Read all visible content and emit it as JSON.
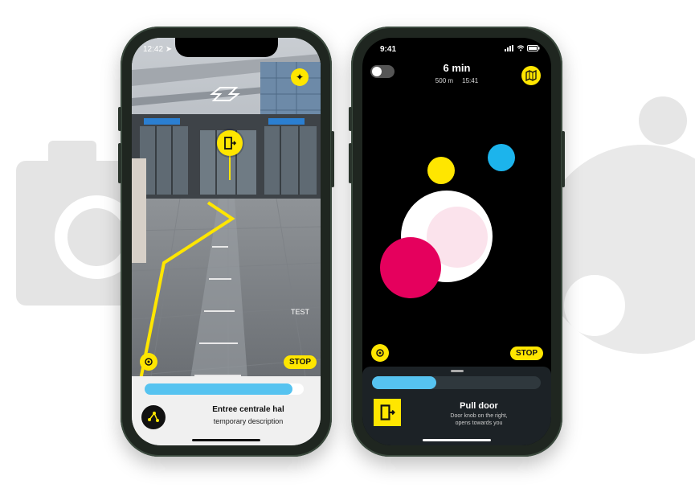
{
  "left_phone": {
    "status_time": "12:42",
    "test_label": "TEST",
    "stop_label": "STOP",
    "progress": 0.93,
    "destination_title": "Entree centrale hal",
    "destination_desc": "temporary description"
  },
  "right_phone": {
    "status_time": "9:41",
    "eta": "6 min",
    "distance": "500 m",
    "arrival_time": "15:41",
    "stop_label": "STOP",
    "progress": 0.38,
    "instruction_title": "Pull door",
    "instruction_line1": "Door knob on the right,",
    "instruction_line2": "opens towards you"
  },
  "colors": {
    "accent_yellow": "#ffe600",
    "progress_blue": "#56c3f0",
    "circle_pink": "#e5005d",
    "circle_blue": "#1cb4ec"
  },
  "icons": [
    "location-arrow-icon",
    "rocket-icon",
    "door-exit-icon",
    "crosshair-icon",
    "route-icon",
    "map-icon",
    "toggle-switch",
    "signal-icon",
    "wifi-icon",
    "battery-icon"
  ]
}
